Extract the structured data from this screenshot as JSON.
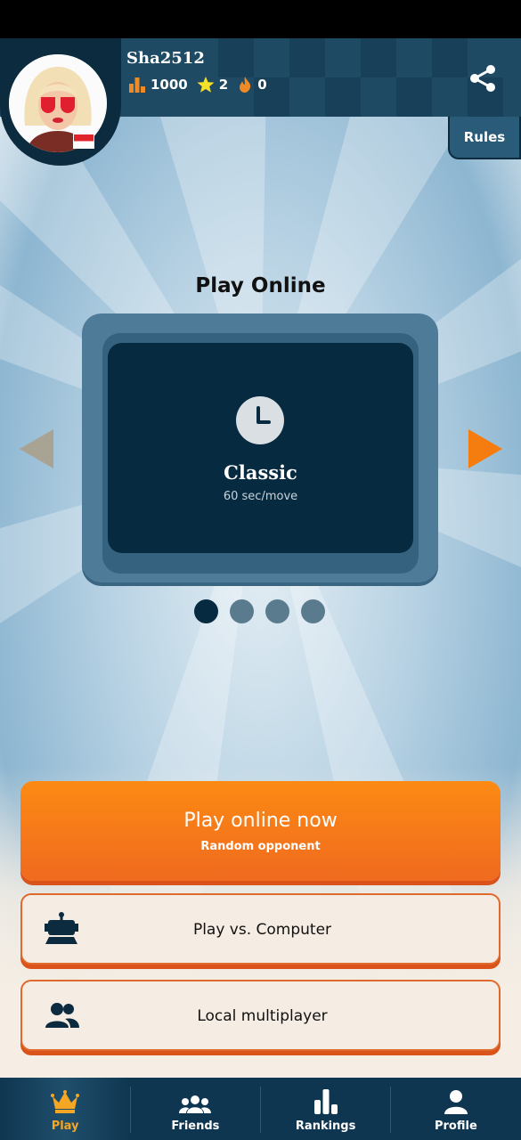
{
  "profile": {
    "username": "Sha2512",
    "rating": "1000",
    "stars": "2",
    "streak": "0"
  },
  "header": {
    "rules_label": "Rules"
  },
  "section": {
    "title": "Play Online"
  },
  "mode_card": {
    "name": "Classic",
    "description": "60 sec/move",
    "icon": "clock-icon"
  },
  "carousel": {
    "pages": 4,
    "active_index": 0
  },
  "buttons": {
    "primary_label": "Play online now",
    "primary_sublabel": "Random opponent",
    "computer_label": "Play vs. Computer",
    "local_label": "Local multiplayer"
  },
  "tabs": [
    {
      "label": "Play",
      "icon": "crown-icon",
      "active": true
    },
    {
      "label": "Friends",
      "icon": "friends-icon",
      "active": false
    },
    {
      "label": "Rankings",
      "icon": "rankings-icon",
      "active": false
    },
    {
      "label": "Profile",
      "icon": "profile-icon",
      "active": false
    }
  ],
  "colors": {
    "accent_orange": "#f57c1f",
    "navy": "#062a40",
    "header": "#1f4a63"
  }
}
